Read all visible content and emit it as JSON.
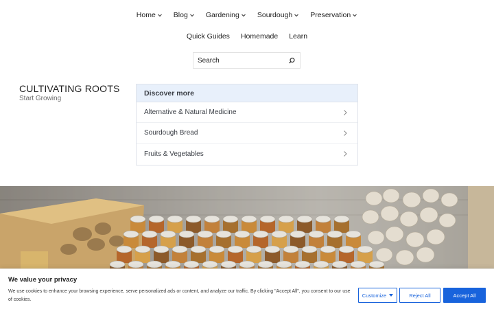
{
  "nav": {
    "primary": [
      {
        "label": "Home",
        "has_dropdown": true
      },
      {
        "label": "Blog",
        "has_dropdown": true
      },
      {
        "label": "Gardening",
        "has_dropdown": true
      },
      {
        "label": "Sourdough",
        "has_dropdown": true
      },
      {
        "label": "Preservation",
        "has_dropdown": true
      }
    ],
    "secondary": [
      {
        "label": "Quick Guides"
      },
      {
        "label": "Homemade"
      },
      {
        "label": "Learn"
      }
    ]
  },
  "search": {
    "placeholder": "Search",
    "value": "",
    "icon": "search-icon"
  },
  "brand": {
    "title": "CULTIVATING ROOTS",
    "tagline": "Start Growing"
  },
  "discover": {
    "heading": "Discover more",
    "items": [
      {
        "label": "Alternative & Natural Medicine"
      },
      {
        "label": "Sourdough Bread"
      },
      {
        "label": "Fruits & Vegetables"
      }
    ]
  },
  "cookie": {
    "title": "We value your privacy",
    "text": "We use cookies to enhance your browsing experience, serve personalized ads or content, and analyze our traffic. By clicking \"Accept All\", you consent to our use of cookies.",
    "customize_label": "Customize",
    "reject_label": "Reject All",
    "accept_label": "Accept All"
  },
  "colors": {
    "accent": "#1863dc",
    "discover_header_bg": "#e8f0fb",
    "text": "#1e1e1e"
  }
}
